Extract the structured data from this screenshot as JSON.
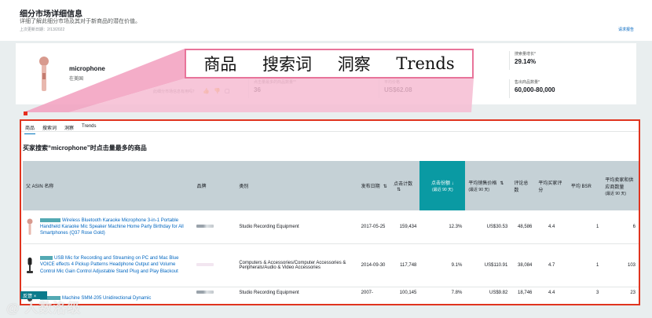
{
  "header": {
    "title": "细分市场详细信息",
    "subtitle": "详细了解此细分市场及其对于新商品的潜在价值。",
    "last_updated": "上次更新日期：2/13/2022",
    "request_link": "请求报告"
  },
  "summary": {
    "product_name": "microphone",
    "market": "在美国",
    "helpful_question": "此细分市场信息有用吗？",
    "metrics": [
      {
        "label": "点击量最多的商品数量**",
        "value": "36"
      },
      {
        "label": "平均价格",
        "value": "US$62.08"
      },
      {
        "label": "搜索量增长*",
        "value": "29.14%"
      },
      {
        "label": "售出商品数量*",
        "value": "60,000-80,000"
      }
    ]
  },
  "callout": {
    "items": [
      "商品",
      "搜索词",
      "洞察",
      "Trends"
    ]
  },
  "tabs": [
    "商品",
    "搜索词",
    "洞察",
    "Trends"
  ],
  "section_title": "买家搜索“microphone”时点击量最多的商品",
  "table": {
    "columns": {
      "asin_name": "父 ASIN 名称",
      "brand": "品牌",
      "category": "类别",
      "release_date": "发布日期",
      "click_count": "点击计数",
      "click_share": "点击份额",
      "click_share_sub": "(最近 90 天)",
      "avg_price": "平均销售价格",
      "avg_price_sub": "(最近 90 天)",
      "review_count": "评论总数",
      "avg_rating": "平均买家评分",
      "avg_bsr": "平均 BSR",
      "avg_sellers": "平均卖家和供应商数量",
      "avg_sellers_sub": "(最近 90 天)"
    },
    "rows": [
      {
        "title": "Wireless Bluetooth Karaoke Microphone 3-in-1 Portable Handheld Karaoke Mic Speaker Machine Home Party Birthday for All Smartphones (Q37 Rose Gold)",
        "category": "Studio Recording Equipment",
        "release_date": "2017-05-25",
        "click_count": "159,434",
        "click_share": "12.3%",
        "avg_price": "US$30.53",
        "review_count": "48,586",
        "avg_rating": "4.4",
        "avg_bsr": "1",
        "avg_sellers": "6"
      },
      {
        "title": "USB Mic for Recording and Streaming on PC and Mac Blue VOICE effects 4 Pickup Patterns Headphone Output and Volume Control Mic Gain Control Adjustable Stand Plug and Play Blackout",
        "category": "Computers & Accessories/Computer Accessories & Peripherals/Audio & Video Accessories",
        "release_date": "2014-09-30",
        "click_count": "117,748",
        "click_share": "9.1%",
        "avg_price": "US$110.91",
        "review_count": "38,084",
        "avg_rating": "4.7",
        "avg_bsr": "1",
        "avg_sellers": "103"
      },
      {
        "title": "Machine SMM-205 Unidirectional Dynamic",
        "category": "Studio Recording Equipment",
        "release_date": "2007-",
        "click_count": "100,145",
        "click_share": "7.8%",
        "avg_price": "US$9.82",
        "review_count": "18,746",
        "avg_rating": "4.4",
        "avg_bsr": "3",
        "avg_sellers": "23"
      }
    ]
  },
  "feedback_chip": "反馈",
  "watermark": "@ 人数洛级",
  "colors": {
    "accent_teal": "#0a9aa3",
    "callout_pink": "#e8749a",
    "frame_red": "#e0341f",
    "link_blue": "#0066c0"
  }
}
